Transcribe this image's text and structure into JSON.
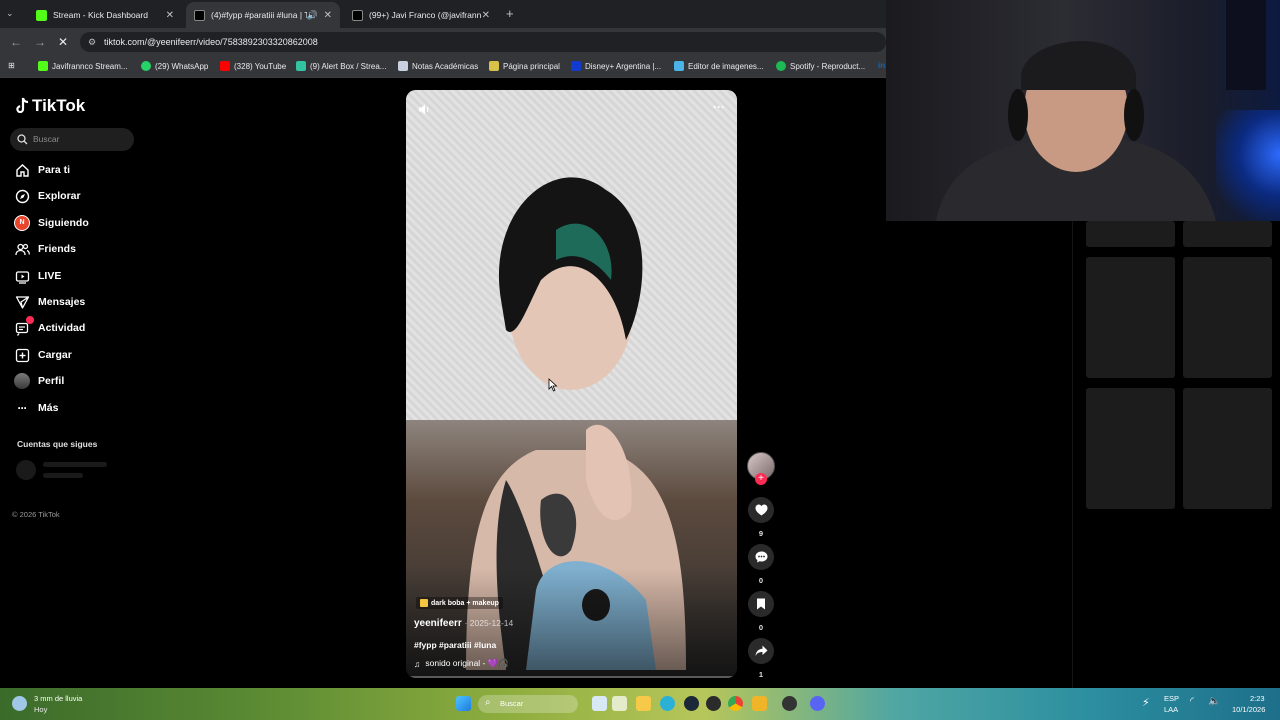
{
  "browser": {
    "tabs": [
      {
        "title": "Stream - Kick Dashboard",
        "color": "#53fc18"
      },
      {
        "title": "(4)#fypp #paratiii #luna | Ti",
        "color": "#ffffff"
      },
      {
        "title": "(99+) Javi Franco (@javifrannco",
        "color": "#ffffff"
      }
    ],
    "new_tab_label": "+",
    "url": "tiktok.com/@yeenifeerr/video/7583892303320862008",
    "bookmarks": [
      {
        "label": "Javifrannco Stream...",
        "color": "#53fc18"
      },
      {
        "label": "(29) WhatsApp",
        "color": "#25d366"
      },
      {
        "label": "(328) YouTube",
        "color": "#ff0000"
      },
      {
        "label": "(9) Alert Box / Strea...",
        "color": "#31c3a2"
      },
      {
        "label": "Notas Académicas",
        "color": "#c9d1e0"
      },
      {
        "label": "Página principal",
        "color": "#d9c24a"
      },
      {
        "label": "Disney+ Argentina |...",
        "color": "#113ccf"
      },
      {
        "label": "Editor de imagenes...",
        "color": "#4ab3e8"
      },
      {
        "label": "Spotify - Reproduct...",
        "color": "#1db954"
      }
    ]
  },
  "sidebar": {
    "logo": "TikTok",
    "search_placeholder": "Buscar",
    "nav": [
      {
        "label": "Para ti",
        "icon": "home-icon"
      },
      {
        "label": "Explorar",
        "icon": "compass-icon"
      },
      {
        "label": "Siguiendo",
        "icon": "following-avatar-icon"
      },
      {
        "label": "Friends",
        "icon": "friends-icon"
      },
      {
        "label": "LIVE",
        "icon": "live-icon"
      },
      {
        "label": "Mensajes",
        "icon": "messages-icon"
      },
      {
        "label": "Actividad",
        "icon": "activity-icon"
      },
      {
        "label": "Cargar",
        "icon": "upload-icon"
      },
      {
        "label": "Perfil",
        "icon": "profile-icon"
      },
      {
        "label": "Más",
        "icon": "more-icon"
      }
    ],
    "following_title": "Cuentas que sigues",
    "copyright": "© 2026 TikTok"
  },
  "video": {
    "effect_tag": "dark boba + makeup",
    "author": "yeenifeerr",
    "date": "· 2025-12-14",
    "hashtags": "#fypp #paratiii #luna",
    "sound": "sonido original - 💜🎧",
    "more_label": "···"
  },
  "actions": {
    "likes": "9",
    "comments": "0",
    "saves": "0",
    "shares": "1"
  },
  "taskbar": {
    "weather": "3 mm de lluvia",
    "weather_sub": "Hoy",
    "search_label": "Buscar",
    "lang": "ESP",
    "lang_sub": "LAA",
    "time": "2:23",
    "date": "10/1/2026"
  },
  "colors": {
    "accent": "#fe2c55",
    "background": "#000000"
  }
}
